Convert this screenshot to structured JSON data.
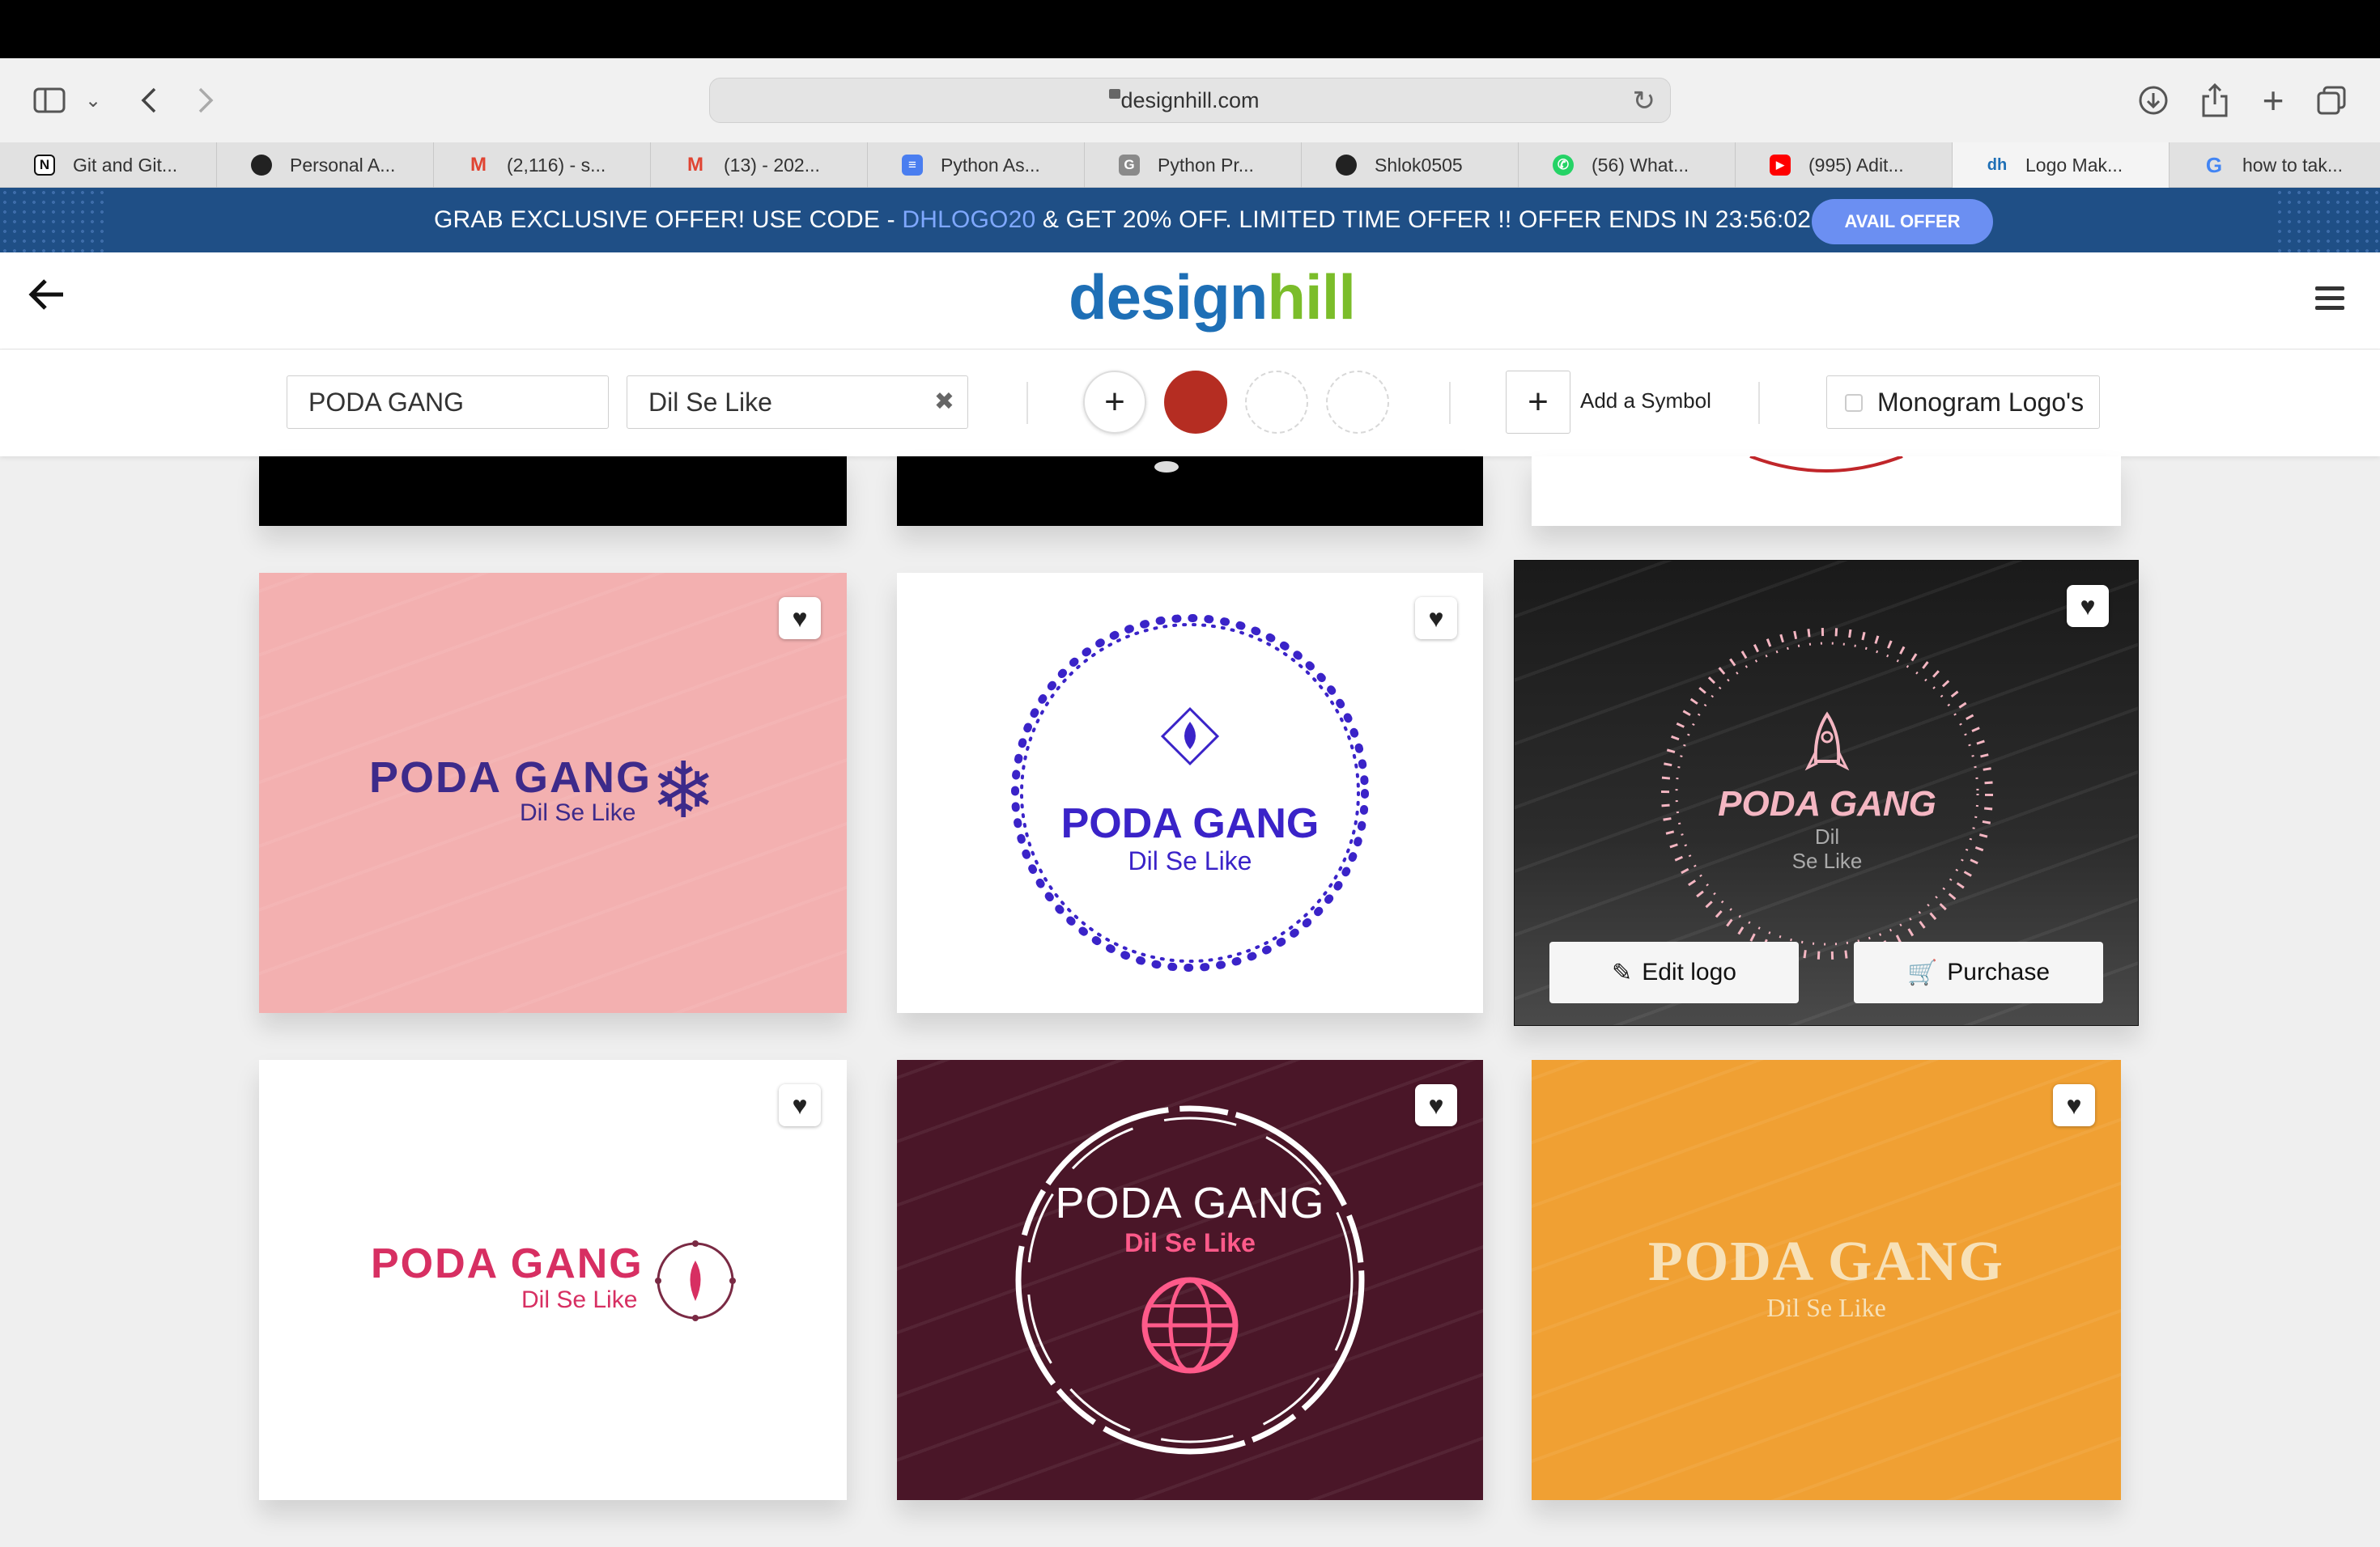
{
  "browser": {
    "address": "designhill.com",
    "tabs": [
      {
        "label": "Git and Git...",
        "icon": "notion-icon",
        "color": "#111111",
        "glyph": "N"
      },
      {
        "label": "Personal A...",
        "icon": "github-icon",
        "color": "#222222",
        "glyph": "●"
      },
      {
        "label": "(2,116) - s...",
        "icon": "gmail-icon",
        "color": "#e04432",
        "glyph": "M"
      },
      {
        "label": "(13) - 202...",
        "icon": "gmail-icon",
        "color": "#e04432",
        "glyph": "M"
      },
      {
        "label": "Python As...",
        "icon": "docs-icon",
        "color": "#4a7ef0",
        "glyph": "≡"
      },
      {
        "label": "Python Pr...",
        "icon": "g-icon",
        "color": "#8a8a8a",
        "glyph": "G"
      },
      {
        "label": "Shlok0505",
        "icon": "github-icon",
        "color": "#222222",
        "glyph": "●"
      },
      {
        "label": "(56) What...",
        "icon": "whatsapp-icon",
        "color": "#25d366",
        "glyph": "✆"
      },
      {
        "label": "(995) Adit...",
        "icon": "youtube-icon",
        "color": "#ff0000",
        "glyph": "▶"
      },
      {
        "label": "Logo Mak...",
        "icon": "designhill-icon",
        "color": "#1e6fb6",
        "glyph": "dh"
      },
      {
        "label": "how to tak...",
        "icon": "google-icon",
        "color": "#4285f4",
        "glyph": "G"
      }
    ]
  },
  "promo": {
    "text_before": "GRAB EXCLUSIVE OFFER! USE CODE - ",
    "code": "DHLOGO20",
    "text_after": " & GET 20% OFF. LIMITED TIME OFFER !! OFFER ENDS IN 23:56:02",
    "button": "AVAIL OFFER"
  },
  "header": {
    "logo_a": "design",
    "logo_b": "hill"
  },
  "filters": {
    "company_name": "PODA GANG",
    "slogan": "Dil Se Like",
    "selected_color": "#b52d22",
    "add_symbol_label": "Add a Symbol",
    "monogram_label": "Monogram Logo's"
  },
  "cards": {
    "edit_label": "Edit logo",
    "purchase_label": "Purchase",
    "pink": {
      "name": "PODA GANG",
      "tagline": "Dil Se Like",
      "bg": "#f3b0b0",
      "ink": "#3d2a8a"
    },
    "circle": {
      "name": "PODA GANG",
      "tagline": "Dil Se Like",
      "bg": "#ffffff",
      "ink": "#3a23c8"
    },
    "dark": {
      "name": "PODA GANG",
      "tagline_1": "Dil",
      "tagline_2": "Se Like",
      "ink": "#f4b6c2"
    },
    "white": {
      "name": "PODA GANG",
      "tagline": "Dil Se Like",
      "ink": "#d72f62"
    },
    "maroon": {
      "name": "PODA GANG",
      "tagline": "Dil Se Like",
      "bg": "#4a1628",
      "ink": "#ff5a8a"
    },
    "orange": {
      "name": "PODA GANG",
      "tagline": "Dil Se Like",
      "bg": "#f0a033",
      "ink": "#f7e1b8"
    }
  }
}
